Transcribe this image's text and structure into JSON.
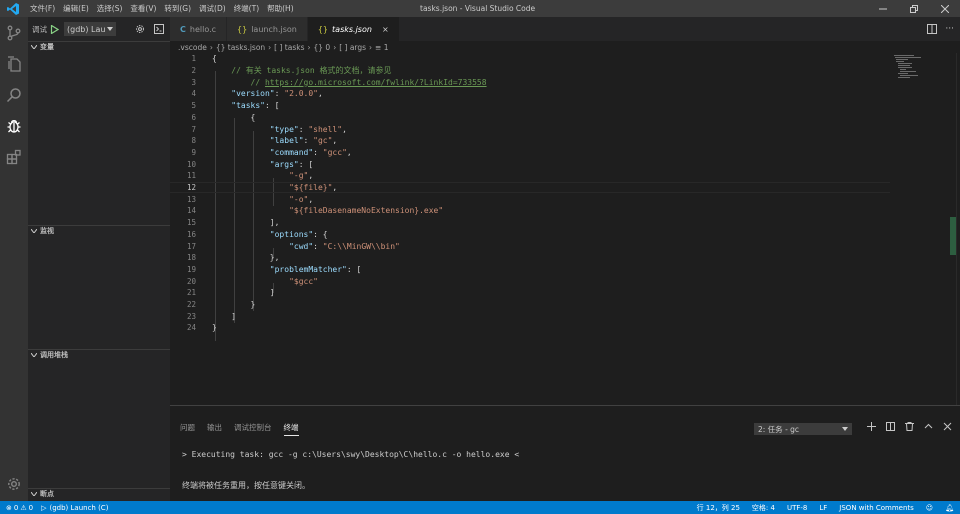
{
  "window": {
    "title": "tasks.json - Visual Studio Code"
  },
  "menu": [
    "文件(F)",
    "编辑(E)",
    "选择(S)",
    "查看(V)",
    "转到(G)",
    "调试(D)",
    "终端(T)",
    "帮助(H)"
  ],
  "sidebar": {
    "run_label": "调试",
    "config": "(gdb) Lau",
    "sections": [
      "变量",
      "监视",
      "调用堆栈",
      "断点"
    ]
  },
  "tabs": [
    {
      "label": "hello.c",
      "icon": "c-file-icon"
    },
    {
      "label": "launch.json",
      "icon": "json-icon"
    },
    {
      "label": "tasks.json",
      "icon": "json-icon",
      "active": true
    }
  ],
  "breadcrumb": [
    ".vscode",
    "{} tasks.json",
    "[ ] tasks",
    "{} 0",
    "[ ] args",
    "≡ 1"
  ],
  "editor": {
    "current_line": 12,
    "lines": [
      "{",
      "    // 有关 tasks.json 格式的文档，请参见",
      "        // https://go.microsoft.com/fwlink/?LinkId=733558",
      "    \"version\": \"2.0.0\",",
      "    \"tasks\": [",
      "        {",
      "            \"type\": \"shell\",",
      "            \"label\": \"gc\",",
      "            \"command\": \"gcc\",",
      "            \"args\": [",
      "                \"-g\",",
      "                \"${file}\",",
      "                \"-o\",",
      "                \"${fileDasenameNoExtension}.exe\"",
      "            ],",
      "            \"options\": {",
      "                \"cwd\": \"C:\\\\MinGW\\\\bin\"",
      "            },",
      "            \"problemMatcher\": [",
      "                \"$gcc\"",
      "            ]",
      "        }",
      "    ]",
      "}"
    ]
  },
  "panel": {
    "tabs": [
      "问题",
      "输出",
      "调试控制台",
      "终端"
    ],
    "active_tab": "终端",
    "terminal_select": "2: 任务 - gc",
    "terminal_lines": [
      "> Executing task: gcc -g c:\\Users\\swy\\Desktop\\C\\hello.c -o hello.exe <",
      "终端将被任务重用，按任意键关闭。"
    ]
  },
  "statusbar": {
    "errors": "0",
    "warnings": "0",
    "debug": "(gdb) Launch (C)",
    "position": "行 12，列 25",
    "spaces": "空格: 4",
    "encoding": "UTF-8",
    "eol": "LF",
    "language": "JSON with Comments"
  },
  "colors": {
    "accent": "#007acc",
    "activity_bar": "#333333",
    "sidebar": "#252526",
    "editor": "#1e1e1e"
  }
}
